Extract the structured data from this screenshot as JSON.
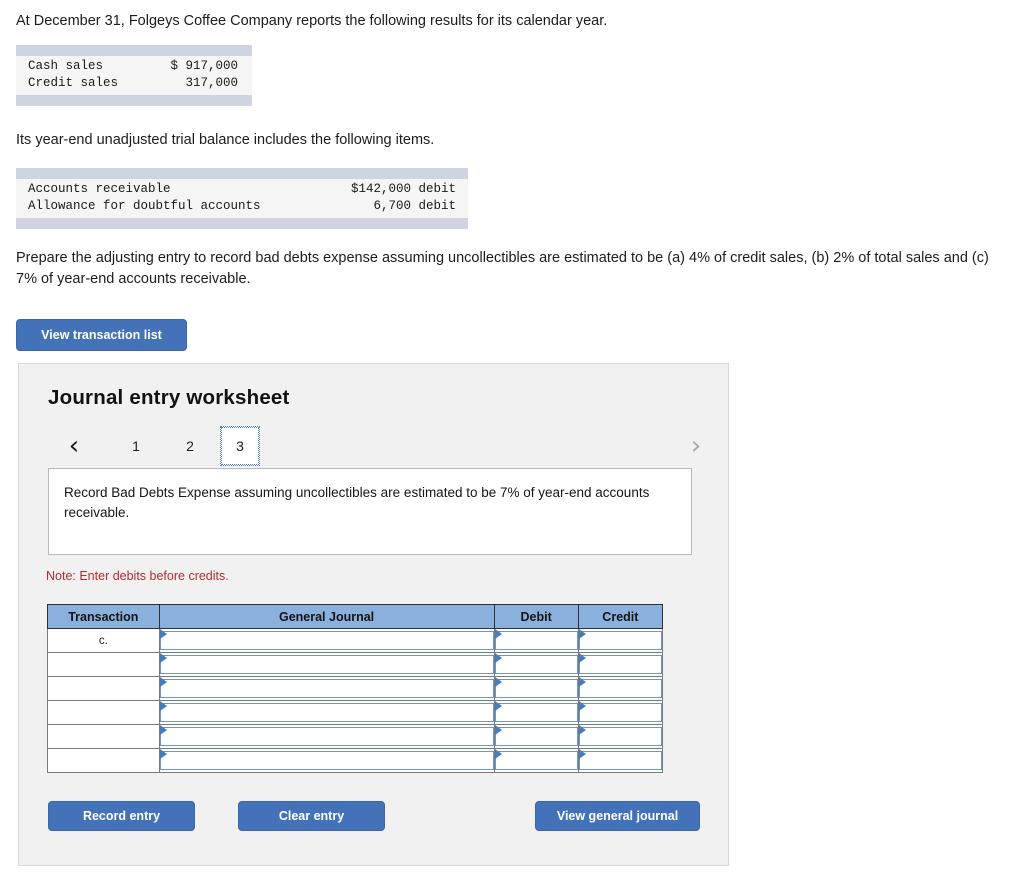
{
  "intro": {
    "line_1": "At December 31, Folgeys Coffee Company reports the following results for its calendar year.",
    "line_2": "Its year-end unadjusted trial balance includes the following items.",
    "task": "Prepare the adjusting entry to record bad debts expense assuming uncollectibles are estimated to be (a) 4% of credit sales, (b) 2% of total sales and (c) 7% of year-end accounts receivable."
  },
  "sales_table": {
    "rows": [
      {
        "label": "Cash sales",
        "value": "$ 917,000"
      },
      {
        "label": "Credit sales",
        "value": "317,000"
      }
    ]
  },
  "trial_balance_table": {
    "rows": [
      {
        "label": "Accounts receivable",
        "value": "$142,000 debit"
      },
      {
        "label": "Allowance for doubtful accounts",
        "value": "6,700 debit"
      }
    ]
  },
  "toolbar": {
    "view_transaction_list_label": "View transaction list"
  },
  "worksheet": {
    "title": "Journal entry worksheet",
    "pager": {
      "prev_icon": "‹",
      "next_icon": "›",
      "tabs": [
        {
          "label": "1",
          "active": false
        },
        {
          "label": "2",
          "active": false
        },
        {
          "label": "3",
          "active": true
        }
      ]
    },
    "instruction": "Record Bad Debts Expense assuming uncollectibles are estimated to be 7% of year-end accounts receivable.",
    "note": "Note: Enter debits before credits.",
    "table": {
      "headers": [
        "Transaction",
        "General Journal",
        "Debit",
        "Credit"
      ],
      "rows": [
        {
          "transaction": "c.",
          "general_journal": "",
          "debit": "",
          "credit": ""
        },
        {
          "transaction": "",
          "general_journal": "",
          "debit": "",
          "credit": ""
        },
        {
          "transaction": "",
          "general_journal": "",
          "debit": "",
          "credit": ""
        },
        {
          "transaction": "",
          "general_journal": "",
          "debit": "",
          "credit": ""
        },
        {
          "transaction": "",
          "general_journal": "",
          "debit": "",
          "credit": ""
        },
        {
          "transaction": "",
          "general_journal": "",
          "debit": "",
          "credit": ""
        }
      ]
    },
    "footer": {
      "record_entry_label": "Record entry",
      "clear_entry_label": "Clear entry",
      "view_general_journal_label": "View general journal"
    }
  },
  "colors": {
    "button_blue": "#4472b8",
    "table_header_blue": "#8ab0de",
    "note_red": "#b52c2c",
    "fact_bar": "#ced4e0",
    "panel_bg": "#f1f1f1"
  }
}
